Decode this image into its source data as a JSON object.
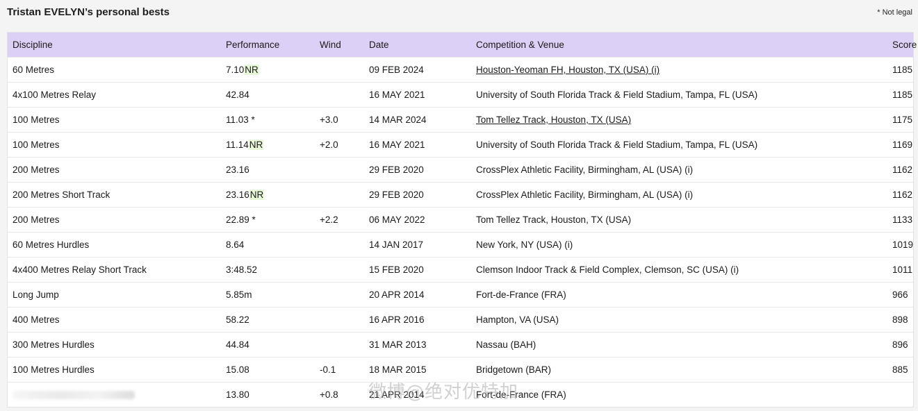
{
  "heading": "Tristan EVELYN’s personal bests",
  "note": "* Not legal",
  "columns": {
    "discipline": "Discipline",
    "performance": "Performance",
    "wind": "Wind",
    "date": "Date",
    "venue": "Competition & Venue",
    "score": "Score"
  },
  "rows": [
    {
      "discipline": "60 Metres",
      "perf": "7.10",
      "flag": "NR",
      "wind": "",
      "date": "09 FEB 2024",
      "venue": "Houston-Yeoman FH, Houston, TX (USA) (i)",
      "link": true,
      "score": "1185"
    },
    {
      "discipline": "4x100 Metres Relay",
      "perf": "42.84",
      "flag": "",
      "wind": "",
      "date": "16 MAY 2021",
      "venue": "University of South Florida Track & Field Stadium, Tampa, FL (USA)",
      "link": false,
      "score": "1185"
    },
    {
      "discipline": "100 Metres",
      "perf": "11.03 *",
      "flag": "",
      "wind": "+3.0",
      "date": "14 MAR 2024",
      "venue": "Tom Tellez Track, Houston, TX (USA)",
      "link": true,
      "score": "1175"
    },
    {
      "discipline": "100 Metres",
      "perf": "11.14",
      "flag": "NR",
      "wind": "+2.0",
      "date": "16 MAY 2021",
      "venue": "University of South Florida Track & Field Stadium, Tampa, FL (USA)",
      "link": false,
      "score": "1169"
    },
    {
      "discipline": "200 Metres",
      "perf": "23.16",
      "flag": "",
      "wind": "",
      "date": "29 FEB 2020",
      "venue": "CrossPlex Athletic Facility, Birmingham, AL (USA) (i)",
      "link": false,
      "score": "1162"
    },
    {
      "discipline": "200 Metres Short Track",
      "perf": "23.16",
      "flag": "NR",
      "wind": "",
      "date": "29 FEB 2020",
      "venue": "CrossPlex Athletic Facility, Birmingham, AL (USA) (i)",
      "link": false,
      "score": "1162"
    },
    {
      "discipline": "200 Metres",
      "perf": "22.89 *",
      "flag": "",
      "wind": "+2.2",
      "date": "06 MAY 2022",
      "venue": "Tom Tellez Track, Houston, TX (USA)",
      "link": false,
      "score": "1133"
    },
    {
      "discipline": "60 Metres Hurdles",
      "perf": "8.64",
      "flag": "",
      "wind": "",
      "date": "14 JAN 2017",
      "venue": "New York, NY (USA) (i)",
      "link": false,
      "score": "1019"
    },
    {
      "discipline": "4x400 Metres Relay Short Track",
      "perf": "3:48.52",
      "flag": "",
      "wind": "",
      "date": "15 FEB 2020",
      "venue": "Clemson Indoor Track & Field Complex, Clemson, SC (USA) (i)",
      "link": false,
      "score": "1011"
    },
    {
      "discipline": "Long Jump",
      "perf": "5.85m",
      "flag": "",
      "wind": "",
      "date": "20 APR 2014",
      "venue": "Fort-de-France (FRA)",
      "link": false,
      "score": "966"
    },
    {
      "discipline": "400 Metres",
      "perf": "58.22",
      "flag": "",
      "wind": "",
      "date": "16 APR 2016",
      "venue": "Hampton, VA (USA)",
      "link": false,
      "score": "898"
    },
    {
      "discipline": "300 Metres Hurdles",
      "perf": "44.84",
      "flag": "",
      "wind": "",
      "date": "31 MAR 2013",
      "venue": "Nassau (BAH)",
      "link": false,
      "score": "896"
    },
    {
      "discipline": "100 Metres Hurdles",
      "perf": "15.08",
      "flag": "",
      "wind": "-0.1",
      "date": "18 MAR 2015",
      "venue": "Bridgetown (BAR)",
      "link": false,
      "score": "885"
    },
    {
      "discipline": "",
      "perf": "13.80",
      "flag": "",
      "wind": "+0.8",
      "date": "21 APR 2014",
      "venue": "Fort-de-France (FRA)",
      "link": false,
      "score": "",
      "blurred": true
    }
  ],
  "watermark": "微博@绝对优特加",
  "colors": {
    "header_bg": "#ddd0f7",
    "nr_highlight": "#e9f7d9"
  }
}
